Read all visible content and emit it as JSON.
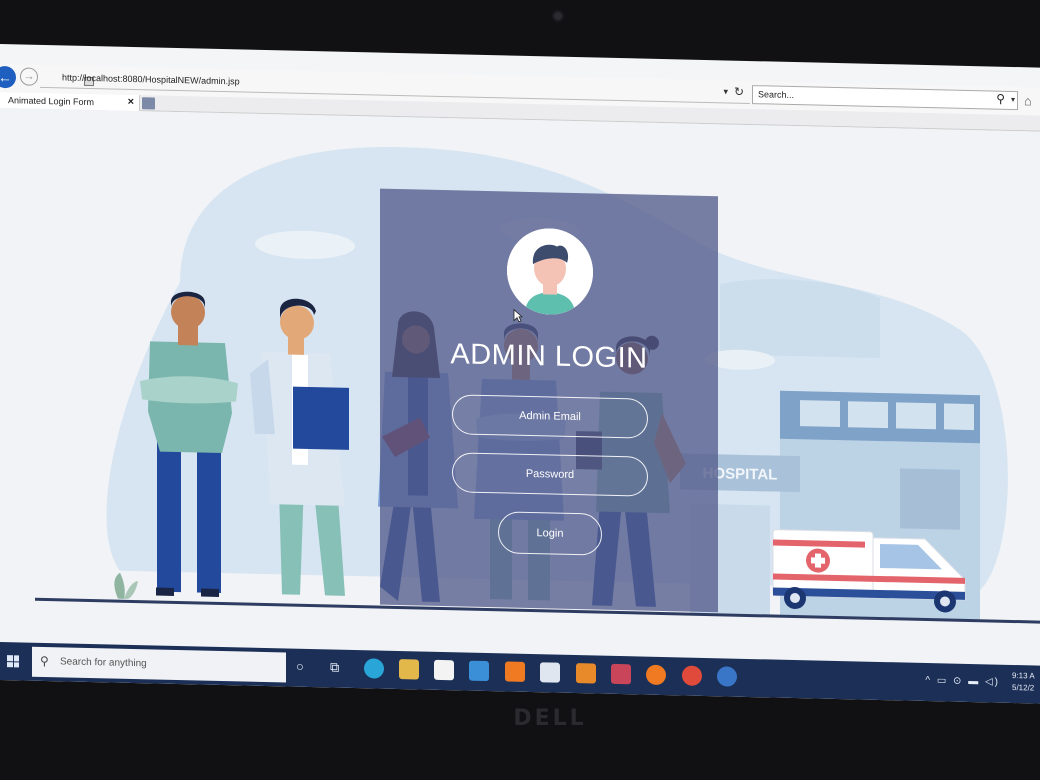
{
  "browser": {
    "url": "http://localhost:8080/HospitalNEW/admin.jsp",
    "search_placeholder": "Search...",
    "tab_title": "Animated Login Form",
    "tab_close": "×"
  },
  "page": {
    "title": "ADMIN LOGIN",
    "email_placeholder": "Admin Email",
    "password_placeholder": "Password",
    "login_label": "Login",
    "building_sign": "HOSPITAL"
  },
  "taskbar": {
    "search_text": "Search for anything",
    "time": "9:13 A",
    "date": "5/12/2"
  },
  "colors": {
    "card": "#545c8c",
    "scrub_teal": "#78b9ad",
    "navy": "#22499b",
    "taskbar": "#1b2f57"
  },
  "bezel_brand": "DELL"
}
